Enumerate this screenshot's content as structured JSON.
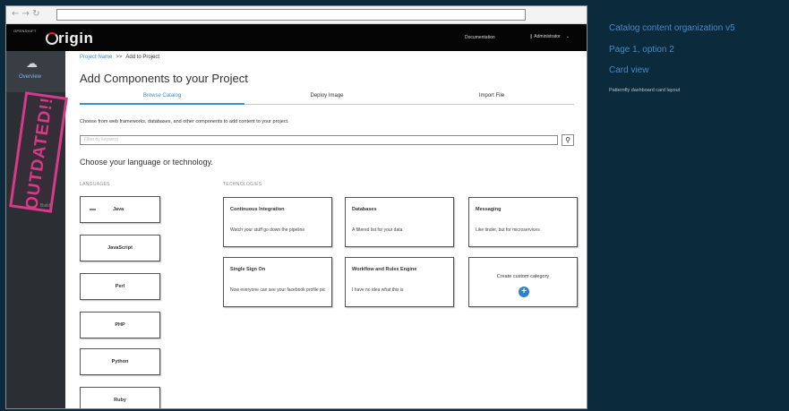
{
  "browser": {
    "nav_glyphs": "← → ↻"
  },
  "header": {
    "logo_small": "OPENSHIFT",
    "logo": "rigin",
    "documentation": "Documentation",
    "user": "❙ Administrator",
    "user_chevron": "⌄"
  },
  "sidebar": {
    "overview_icon": "☁",
    "overview_label": "Overview",
    "ghost_label": "Builds"
  },
  "stamp": {
    "text": "OUTDATED!!"
  },
  "breadcrumb": {
    "link": "Project Name",
    "sep": ">>",
    "current": "Add to Project"
  },
  "page": {
    "title": "Add Components to your Project",
    "intro": "Choose from web frameworks, databases, and other components to add content to your project.",
    "search_placeholder": "Filter by keyword",
    "search_icon": "🔍",
    "choose_heading": "Choose your language or technology."
  },
  "tabs": [
    {
      "label": "Browse Catalog",
      "active": true
    },
    {
      "label": "Deploy Image",
      "active": false
    },
    {
      "label": "Import File",
      "active": false
    }
  ],
  "columns": {
    "languages": "LANGUAGES",
    "technologies": "TECHNOLOGIES"
  },
  "languages": [
    {
      "label": "Java",
      "icon": "java-icon"
    },
    {
      "label": "JavaScript"
    },
    {
      "label": "Perl"
    },
    {
      "label": "PHP"
    },
    {
      "label": "Python"
    },
    {
      "label": "Ruby"
    }
  ],
  "technologies": [
    {
      "title": "Continuous Integration",
      "description": "Watch your stuff go down the pipeline"
    },
    {
      "title": "Databases",
      "description": "A filtered list for your data"
    },
    {
      "title": "Messaging",
      "description": "Like tinder, but for microservices"
    },
    {
      "title": "Single Sign On",
      "description": "Now everyone can see your facebook profile pic"
    },
    {
      "title": "Workflow and Rules Engine",
      "description": "I have no idea what this is"
    }
  ],
  "custom_category": {
    "label": "Create custom category",
    "icon": "plus-circle-icon"
  },
  "annotation": {
    "title": "Catalog content organization v5",
    "subtitle_page": "Page 1, option 2",
    "section": "Card view",
    "note": "Patternfly dashboard card layout"
  },
  "colors": {
    "accent": "#3a8fd6",
    "stamp": "#d83a8a",
    "background": "#0b2a3b"
  }
}
